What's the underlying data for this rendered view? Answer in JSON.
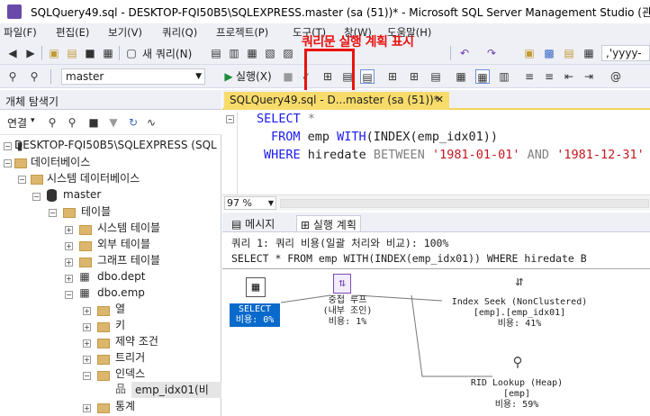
{
  "window": {
    "title": "SQLQuery49.sql - DESKTOP-FQI50B5\\SQLEXPRESS.master (sa (51))* - Microsoft SQL Server Management Studio (관리자)"
  },
  "menu": [
    "파일(F)",
    "편집(E)",
    "보기(V)",
    "쿼리(Q)",
    "프로젝트(P)",
    "도구(T)",
    "창(W)",
    "도움말(H)"
  ],
  "toolbar": {
    "new_query": "새 쿼리(N)",
    "date_format": ",'yyyy-mm",
    "database": "master",
    "execute": "실행(X)"
  },
  "annotation": "쿼리문 실행 계획 표시",
  "explorer": {
    "title": "개체 탐색기",
    "connect": "연결",
    "tree": [
      {
        "label": "DESKTOP-FQI50B5\\SQLEXPRESS (SQL"
      },
      {
        "label": "데이터베이스"
      },
      {
        "label": "시스템 데이터베이스"
      },
      {
        "label": "master"
      },
      {
        "label": "테이블"
      },
      {
        "label": "시스템 테이블"
      },
      {
        "label": "외부 테이블"
      },
      {
        "label": "그래프 테이블"
      },
      {
        "label": "dbo.dept"
      },
      {
        "label": "dbo.emp"
      },
      {
        "label": "열"
      },
      {
        "label": "키"
      },
      {
        "label": "제약 조건"
      },
      {
        "label": "트리거"
      },
      {
        "label": "인덱스"
      },
      {
        "label": "emp_idx01(비"
      },
      {
        "label": "통계"
      }
    ]
  },
  "tabs": {
    "active": "SQLQuery49.sql - D...master (sa (51))*"
  },
  "editor": {
    "line1_kw": "SELECT",
    "line1_rest": " *",
    "line2_kw1": "FROM",
    "line2_a": " emp ",
    "line2_kw2": "WITH",
    "line2_b": "(INDEX(emp_idx01))",
    "line3_kw1": "WHERE",
    "line3_a": " hiredate ",
    "line3_kw2": "BETWEEN",
    "line3_s1": "'1981-01-01'",
    "line3_kw3": "AND",
    "line3_s2": "'1981-12-31'"
  },
  "zoom": "97 %",
  "result_tabs": {
    "messages": "메시지",
    "plan": "실행 계획"
  },
  "plan": {
    "header1": "쿼리 1: 쿼리 비용(일괄 처리와 비교): 100%",
    "header2": "SELECT * FROM emp WITH(INDEX(emp_idx01)) WHERE hiredate B",
    "select": {
      "name": "SELECT",
      "cost": "비용: 0%"
    },
    "nested": {
      "name": "중첩 루프",
      "sub": "(내부 조인)",
      "cost": "비용: 1%"
    },
    "seek": {
      "name": "Index Seek (NonClustered)",
      "obj": "[emp].[emp_idx01]",
      "cost": "비용: 41%"
    },
    "rid": {
      "name": "RID Lookup (Heap)",
      "obj": "[emp]",
      "cost": "비용: 59%"
    }
  },
  "colors": {
    "accent": "#e8130f",
    "tab": "#f8dc6b",
    "keyword": "#1a1af0",
    "string": "#c4171f"
  }
}
